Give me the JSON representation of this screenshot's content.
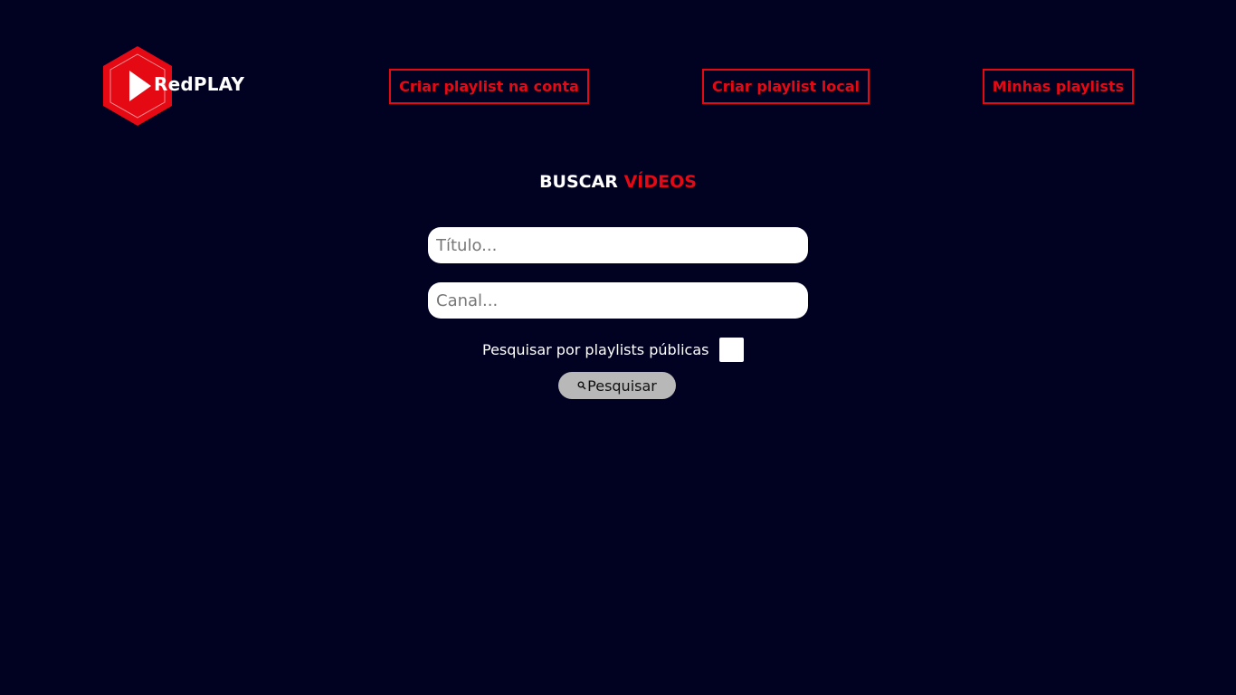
{
  "header": {
    "logo_text": "RedPLAY",
    "nav": [
      {
        "label": "Criar playlist na conta"
      },
      {
        "label": "Criar playlist local"
      },
      {
        "label": "Minhas playlists"
      }
    ]
  },
  "search": {
    "title_main": "BUSCAR",
    "title_accent": "VÍDEOS",
    "title_placeholder": "Título...",
    "channel_placeholder": "Canal...",
    "public_label": "Pesquisar por playlists públicas",
    "public_checked": false,
    "button_label": "Pesquisar",
    "button_icon": "search-icon"
  },
  "colors": {
    "background": "#010221",
    "accent": "#e50914",
    "button_bg": "#b8b8b8"
  }
}
